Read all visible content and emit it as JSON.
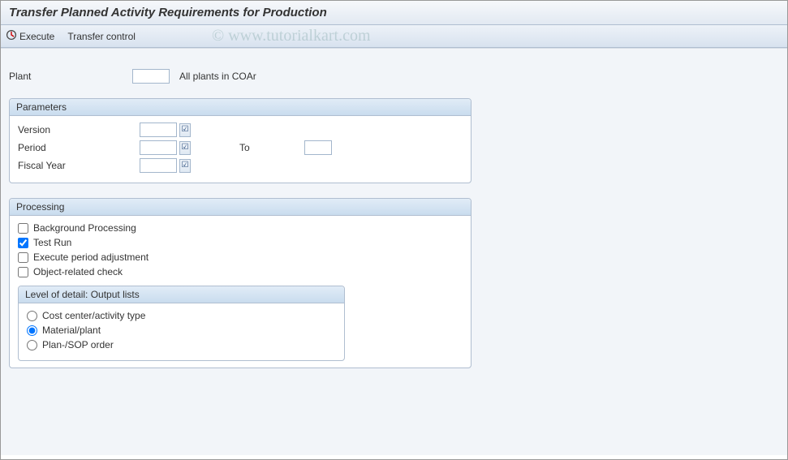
{
  "title": "Transfer Planned Activity Requirements for Production",
  "watermark": "© www.tutorialkart.com",
  "toolbar": {
    "execute": "Execute",
    "transfer_control": "Transfer control"
  },
  "plant": {
    "label": "Plant",
    "value": "",
    "after": "All plants in COAr"
  },
  "parameters": {
    "title": "Parameters",
    "version_label": "Version",
    "version_value": "",
    "period_label": "Period",
    "period_value": "",
    "to_label": "To",
    "to_value": "",
    "fiscal_label": "Fiscal Year",
    "fiscal_value": ""
  },
  "processing": {
    "title": "Processing",
    "background": "Background Processing",
    "test_run": "Test Run",
    "exec_period": "Execute period adjustment",
    "obj_check": "Object-related check",
    "background_checked": false,
    "test_run_checked": true,
    "exec_period_checked": false,
    "obj_check_checked": false,
    "level_title": "Level of detail: Output lists",
    "radios": {
      "cc": "Cost center/activity type",
      "mp": "Material/plant",
      "sop": "Plan-/SOP order",
      "selected": "mp"
    }
  }
}
